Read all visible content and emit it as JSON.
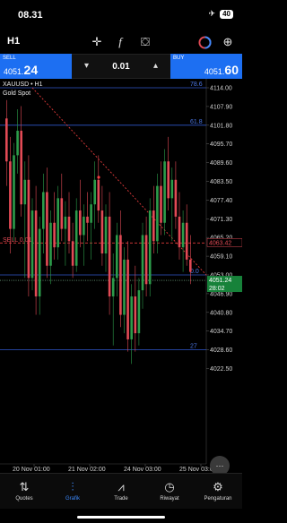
{
  "status": {
    "time": "08.31",
    "battery": "40"
  },
  "toolbar": {
    "timeframe": "H1",
    "icons": [
      "crosshair-icon",
      "function-icon",
      "objects-icon",
      "trade-toggle-icon"
    ]
  },
  "trade": {
    "sell_label": "SELL",
    "sell_price_small": "4051.",
    "sell_price_big": "24",
    "volume": "0.01",
    "buy_label": "BUY",
    "buy_price_small": "4051.",
    "buy_price_big": "60"
  },
  "chart": {
    "symbol_line": "XAUUSD • H1",
    "description": "Gold Spot",
    "price_ticks": [
      "4114.00",
      "4107.90",
      "4101.80",
      "4095.70",
      "4089.60",
      "4083.50",
      "4077.40",
      "4071.30",
      "4065.20",
      "4059.10",
      "4053.00",
      "4046.90",
      "4040.80",
      "4034.70",
      "4028.60",
      "4022.50"
    ],
    "time_labels": [
      "20 Nov 01:00",
      "21 Nov 02:00",
      "24 Nov 03:00",
      "25 Nov 03:00"
    ],
    "fib_labels": [
      "78.6",
      "61.8",
      "0.0",
      "27"
    ],
    "sell_line_label": "SELL 0.01",
    "sell_line_price": "4063.42",
    "bid_tag": "4051.24",
    "countdown": "28:02"
  },
  "colors": {
    "bull": "#2c9c4a",
    "bear": "#e24a55",
    "accent": "#3d8bff",
    "level": "#2f56c9"
  },
  "tabs": [
    {
      "label": "Quotes",
      "icon": "quotes-icon",
      "glyph": "⇅",
      "active": false
    },
    {
      "label": "Grafik",
      "icon": "chart-icon",
      "glyph": "⫶",
      "active": true
    },
    {
      "label": "Trade",
      "icon": "trade-icon",
      "glyph": "⩘",
      "active": false
    },
    {
      "label": "Riwayat",
      "icon": "history-icon",
      "glyph": "◷",
      "active": false
    },
    {
      "label": "Pengaturan",
      "icon": "settings-icon",
      "glyph": "⚙",
      "active": false
    }
  ]
}
